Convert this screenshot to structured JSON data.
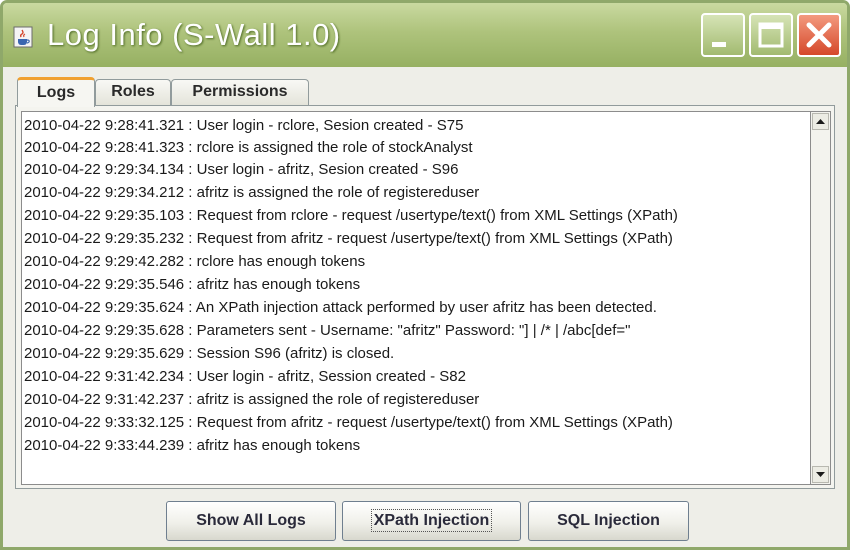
{
  "window": {
    "title": "Log Info (S-Wall 1.0)",
    "icon": "java-cup-icon",
    "controls": [
      "minimize-icon",
      "maximize-icon",
      "close-icon"
    ]
  },
  "tabs": [
    {
      "label": "Logs",
      "active": true
    },
    {
      "label": "Roles",
      "active": false
    },
    {
      "label": "Permissions",
      "active": false
    }
  ],
  "logs": [
    "2010-04-22 9:28:41.321 : User login - rclore, Sesion created - S75",
    "2010-04-22 9:28:41.323 : rclore is assigned the role of stockAnalyst",
    "2010-04-22 9:29:34.134 : User login - afritz, Sesion created - S96",
    "2010-04-22 9:29:34.212 : afritz is assigned the role of registereduser",
    "2010-04-22 9:29:35.103 : Request from rclore - request /usertype/text() from XML Settings (XPath)",
    "2010-04-22 9:29:35.232 : Request from afritz - request /usertype/text() from XML Settings (XPath)",
    "2010-04-22 9:29:42.282 : rclore has enough tokens",
    "2010-04-22 9:29:35.546 : afritz has enough tokens",
    "2010-04-22 9:29:35.624 : An XPath injection attack performed by user afritz has been detected.",
    "2010-04-22 9:29:35.628 : Parameters sent - Username: \"afritz\" Password: \"] | /* | /abc[def=\"",
    "2010-04-22 9:29:35.629 : Session S96 (afritz) is closed.",
    "2010-04-22 9:31:42.234 : User login - afritz, Session created - S82",
    "2010-04-22 9:31:42.237 : afritz is assigned the role of registereduser",
    "2010-04-22 9:33:32.125 : Request from afritz - request /usertype/text() from XML Settings (XPath)",
    "2010-04-22 9:33:44.239 : afritz has enough tokens"
  ],
  "buttons": {
    "show_all": "Show All Logs",
    "xpath": "XPath Injection",
    "sql": "SQL Injection"
  }
}
